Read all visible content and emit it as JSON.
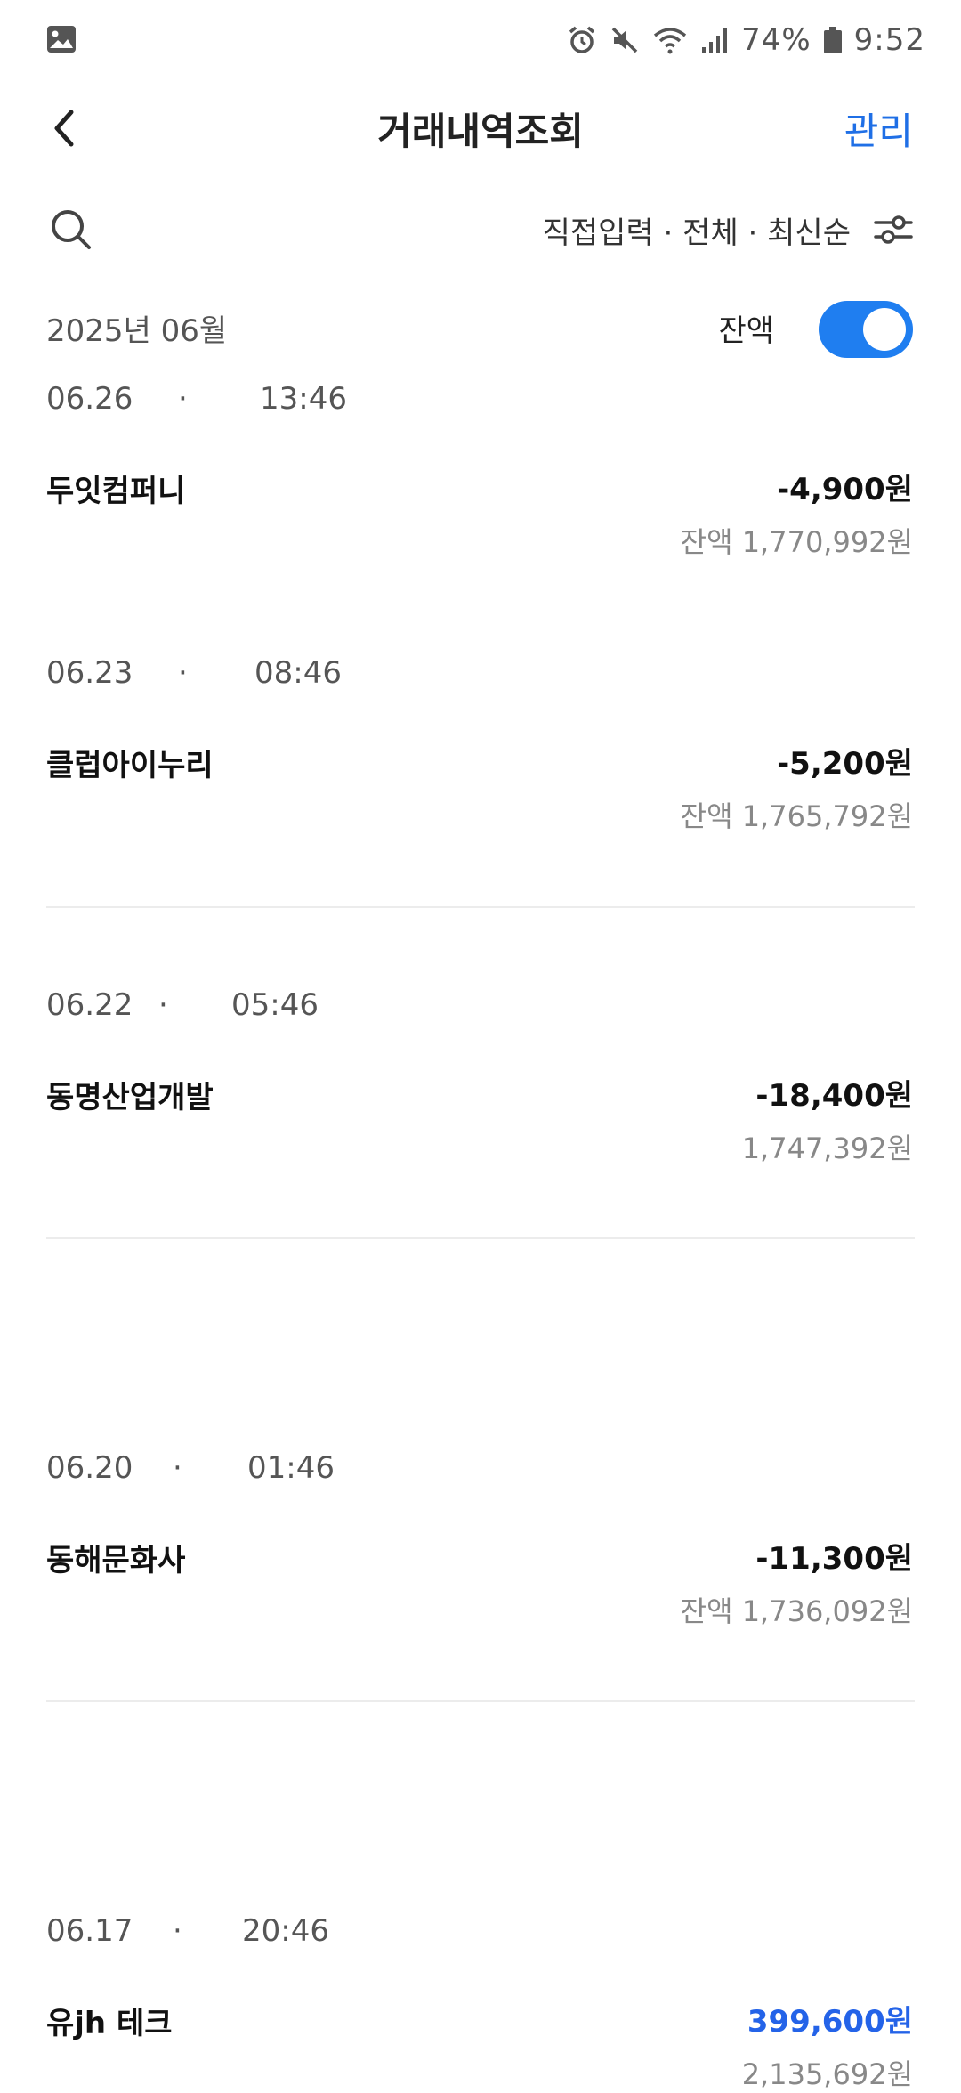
{
  "status_bar": {
    "gallery_icon": "image-icon",
    "alarm_icon": "alarm-icon",
    "mute_icon": "mute-icon",
    "wifi_icon": "wifi-icon",
    "signal_icon": "signal-icon",
    "battery_percent": "74%",
    "time": "9:52"
  },
  "header": {
    "back_icon": "chevron-left-icon",
    "title": "거래내역조회",
    "manage_label": "관리"
  },
  "filter": {
    "search_icon": "search-icon",
    "summary": "직접입력 · 전체 · 최신순",
    "settings_icon": "filter-sliders-icon"
  },
  "month": {
    "label": "2025년 06월",
    "balance_toggle_label": "잔액",
    "balance_toggle_on": true
  },
  "colors": {
    "accent": "#1f7ef0",
    "link": "#1f6fe6",
    "positive_amount": "#2463e8",
    "muted_text": "#888888",
    "divider": "#ececec"
  },
  "transactions": [
    {
      "date": "06.26",
      "dot": "·",
      "time": "13:46",
      "name": "두잇컴퍼니",
      "amount": "-4,900원",
      "balance": "잔액 1,770,992원"
    },
    {
      "date": "06.23",
      "dot": "·",
      "time": "08:46",
      "name": "클럽아이누리",
      "amount": "-5,200원",
      "balance": "잔액 1,765,792원"
    },
    {
      "date": "06.22",
      "dot": "·",
      "time": "05:46",
      "name": "동명산업개발",
      "amount": "-18,400원",
      "balance": "1,747,392원"
    },
    {
      "date": "06.20",
      "dot": "·",
      "time": "01:46",
      "name": "동해문화사",
      "amount": "-11,300원",
      "balance": "잔액 1,736,092원"
    },
    {
      "date": "06.17",
      "dot": "·",
      "time": "20:46",
      "name": "유jh 테크",
      "amount": "399,600원",
      "balance": "2,135,692원"
    }
  ]
}
